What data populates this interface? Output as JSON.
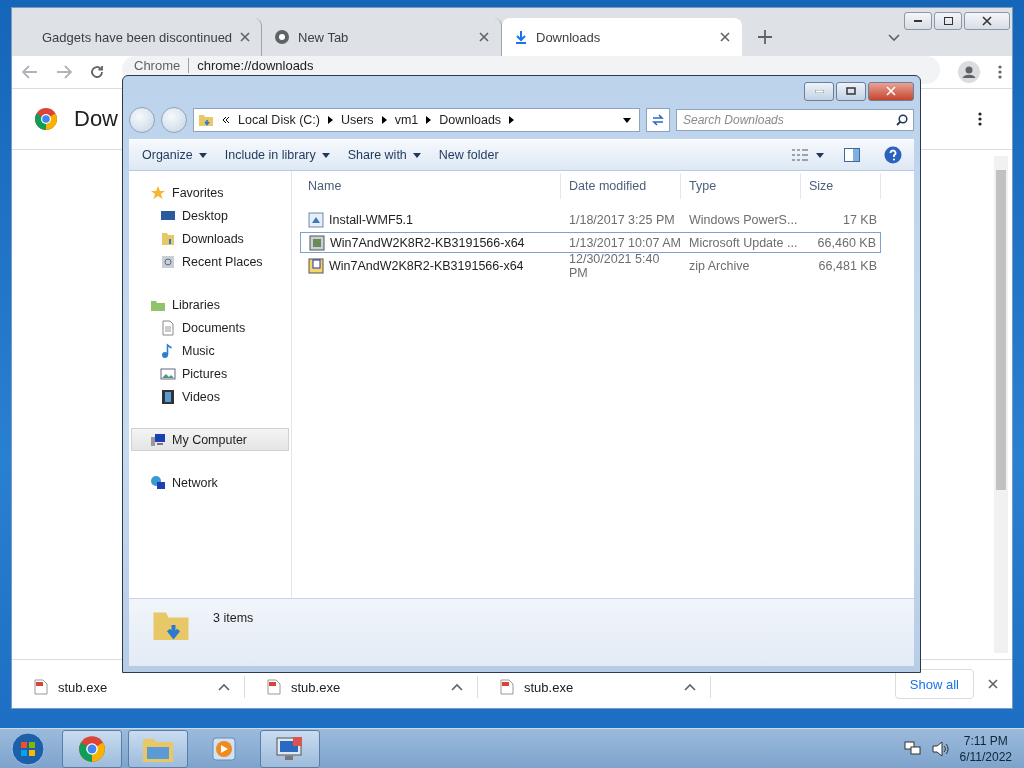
{
  "browser": {
    "tabs": [
      {
        "title": "Gadgets have been discontinued",
        "selected": false
      },
      {
        "title": "New Tab",
        "selected": false
      },
      {
        "title": "Downloads",
        "selected": true
      }
    ],
    "address": {
      "label": "Chrome",
      "url": "chrome://downloads"
    },
    "page_heading": "Dow",
    "downloads_bar": {
      "items": [
        {
          "filename": "stub.exe"
        },
        {
          "filename": "stub.exe"
        },
        {
          "filename": "stub.exe"
        }
      ],
      "show_all": "Show all"
    }
  },
  "explorer": {
    "breadcrumb": [
      "Local Disk (C:)",
      "Users",
      "vm1",
      "Downloads"
    ],
    "search_placeholder": "Search Downloads",
    "commands": [
      {
        "label": "Organize",
        "dropdown": true
      },
      {
        "label": "Include in library",
        "dropdown": true
      },
      {
        "label": "Share with",
        "dropdown": true
      },
      {
        "label": "New folder",
        "dropdown": false
      }
    ],
    "nav": [
      {
        "label": "Favorites",
        "selected": false,
        "children": [
          {
            "label": "Desktop",
            "selected": false
          },
          {
            "label": "Downloads",
            "selected": false
          },
          {
            "label": "Recent Places",
            "selected": false
          }
        ]
      },
      {
        "label": "Libraries",
        "selected": false,
        "children": [
          {
            "label": "Documents",
            "selected": false
          },
          {
            "label": "Music",
            "selected": false
          },
          {
            "label": "Pictures",
            "selected": false
          },
          {
            "label": "Videos",
            "selected": false
          }
        ]
      },
      {
        "label": "My Computer",
        "selected": true
      },
      {
        "label": "Network",
        "selected": false
      }
    ],
    "columns": [
      "Name",
      "Date modified",
      "Type",
      "Size"
    ],
    "rows": [
      {
        "name": "Install-WMF5.1",
        "date": "1/18/2017 3:25 PM",
        "type": "Windows PowerS...",
        "size": "17 KB",
        "selected": false
      },
      {
        "name": "Win7AndW2K8R2-KB3191566-x64",
        "date": "1/13/2017 10:07 AM",
        "type": "Microsoft Update ...",
        "size": "66,460 KB",
        "selected": true
      },
      {
        "name": "Win7AndW2K8R2-KB3191566-x64",
        "date": "12/30/2021 5:40 PM",
        "type": "zip Archive",
        "size": "66,481 KB",
        "selected": false
      }
    ],
    "status": "3 items"
  },
  "taskbar": {
    "apps": [
      {
        "kind": "chrome",
        "running": true
      },
      {
        "kind": "explorer",
        "running": true
      },
      {
        "kind": "media",
        "running": false
      },
      {
        "kind": "remote",
        "running": true
      }
    ],
    "time": "7:11 PM",
    "date": "6/11/2022"
  }
}
